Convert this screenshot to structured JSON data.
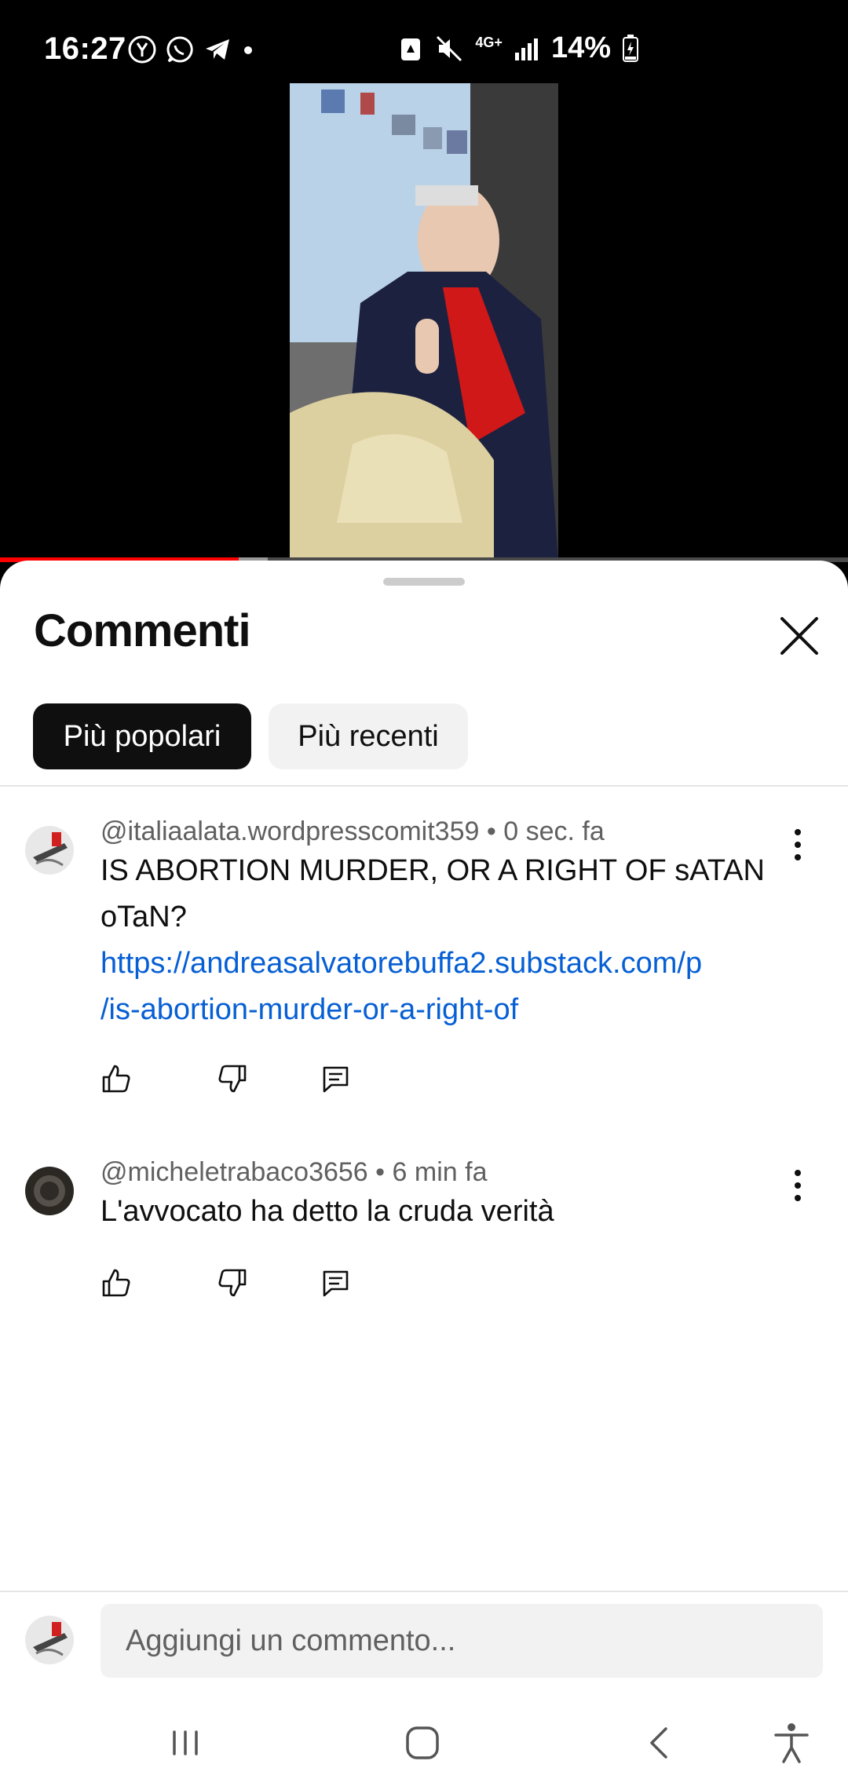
{
  "status_bar": {
    "time": "16:27",
    "network": "4G+",
    "battery": "14%",
    "icons_left": [
      "yandex-icon",
      "whatsapp-icon",
      "telegram-icon",
      "notification-dot"
    ],
    "icons_right": [
      "recycle-icon",
      "mute-icon",
      "4g-data-icon",
      "signal-icon",
      "battery-charging-icon"
    ]
  },
  "video": {
    "progress_fraction": 0.281,
    "buffered_fraction": 0.316
  },
  "comments_panel": {
    "title": "Commenti",
    "close_icon": "close-icon",
    "filters": [
      {
        "label": "Più popolari",
        "selected": true
      },
      {
        "label": "Più recenti",
        "selected": false
      }
    ],
    "comments": [
      {
        "author": "@italiaalata.wordpresscomit359",
        "time": "0 sec. fa",
        "text": "IS ABORTION MURDER, OR A RIGHT OF sATAN oTaN?",
        "link": "https://andreasalvatorebuffa2.substack.com/p/is-abortion-murder-or-a-right-of",
        "link_lines": [
          "https://andreasalvatorebuffa2.substack.com/p",
          "/is-abortion-murder-or-a-right-of"
        ]
      },
      {
        "author": "@micheletrabaco3656",
        "time": "6 min fa",
        "text": "L'avvocato ha detto la cruda verità"
      }
    ],
    "add_comment_placeholder": "Aggiungi un commento..."
  },
  "colors": {
    "accent_red": "#ff0000",
    "link_blue": "#065fd4",
    "chip_selected_bg": "#0f0f0f",
    "chip_unselected_bg": "#f2f2f2"
  }
}
